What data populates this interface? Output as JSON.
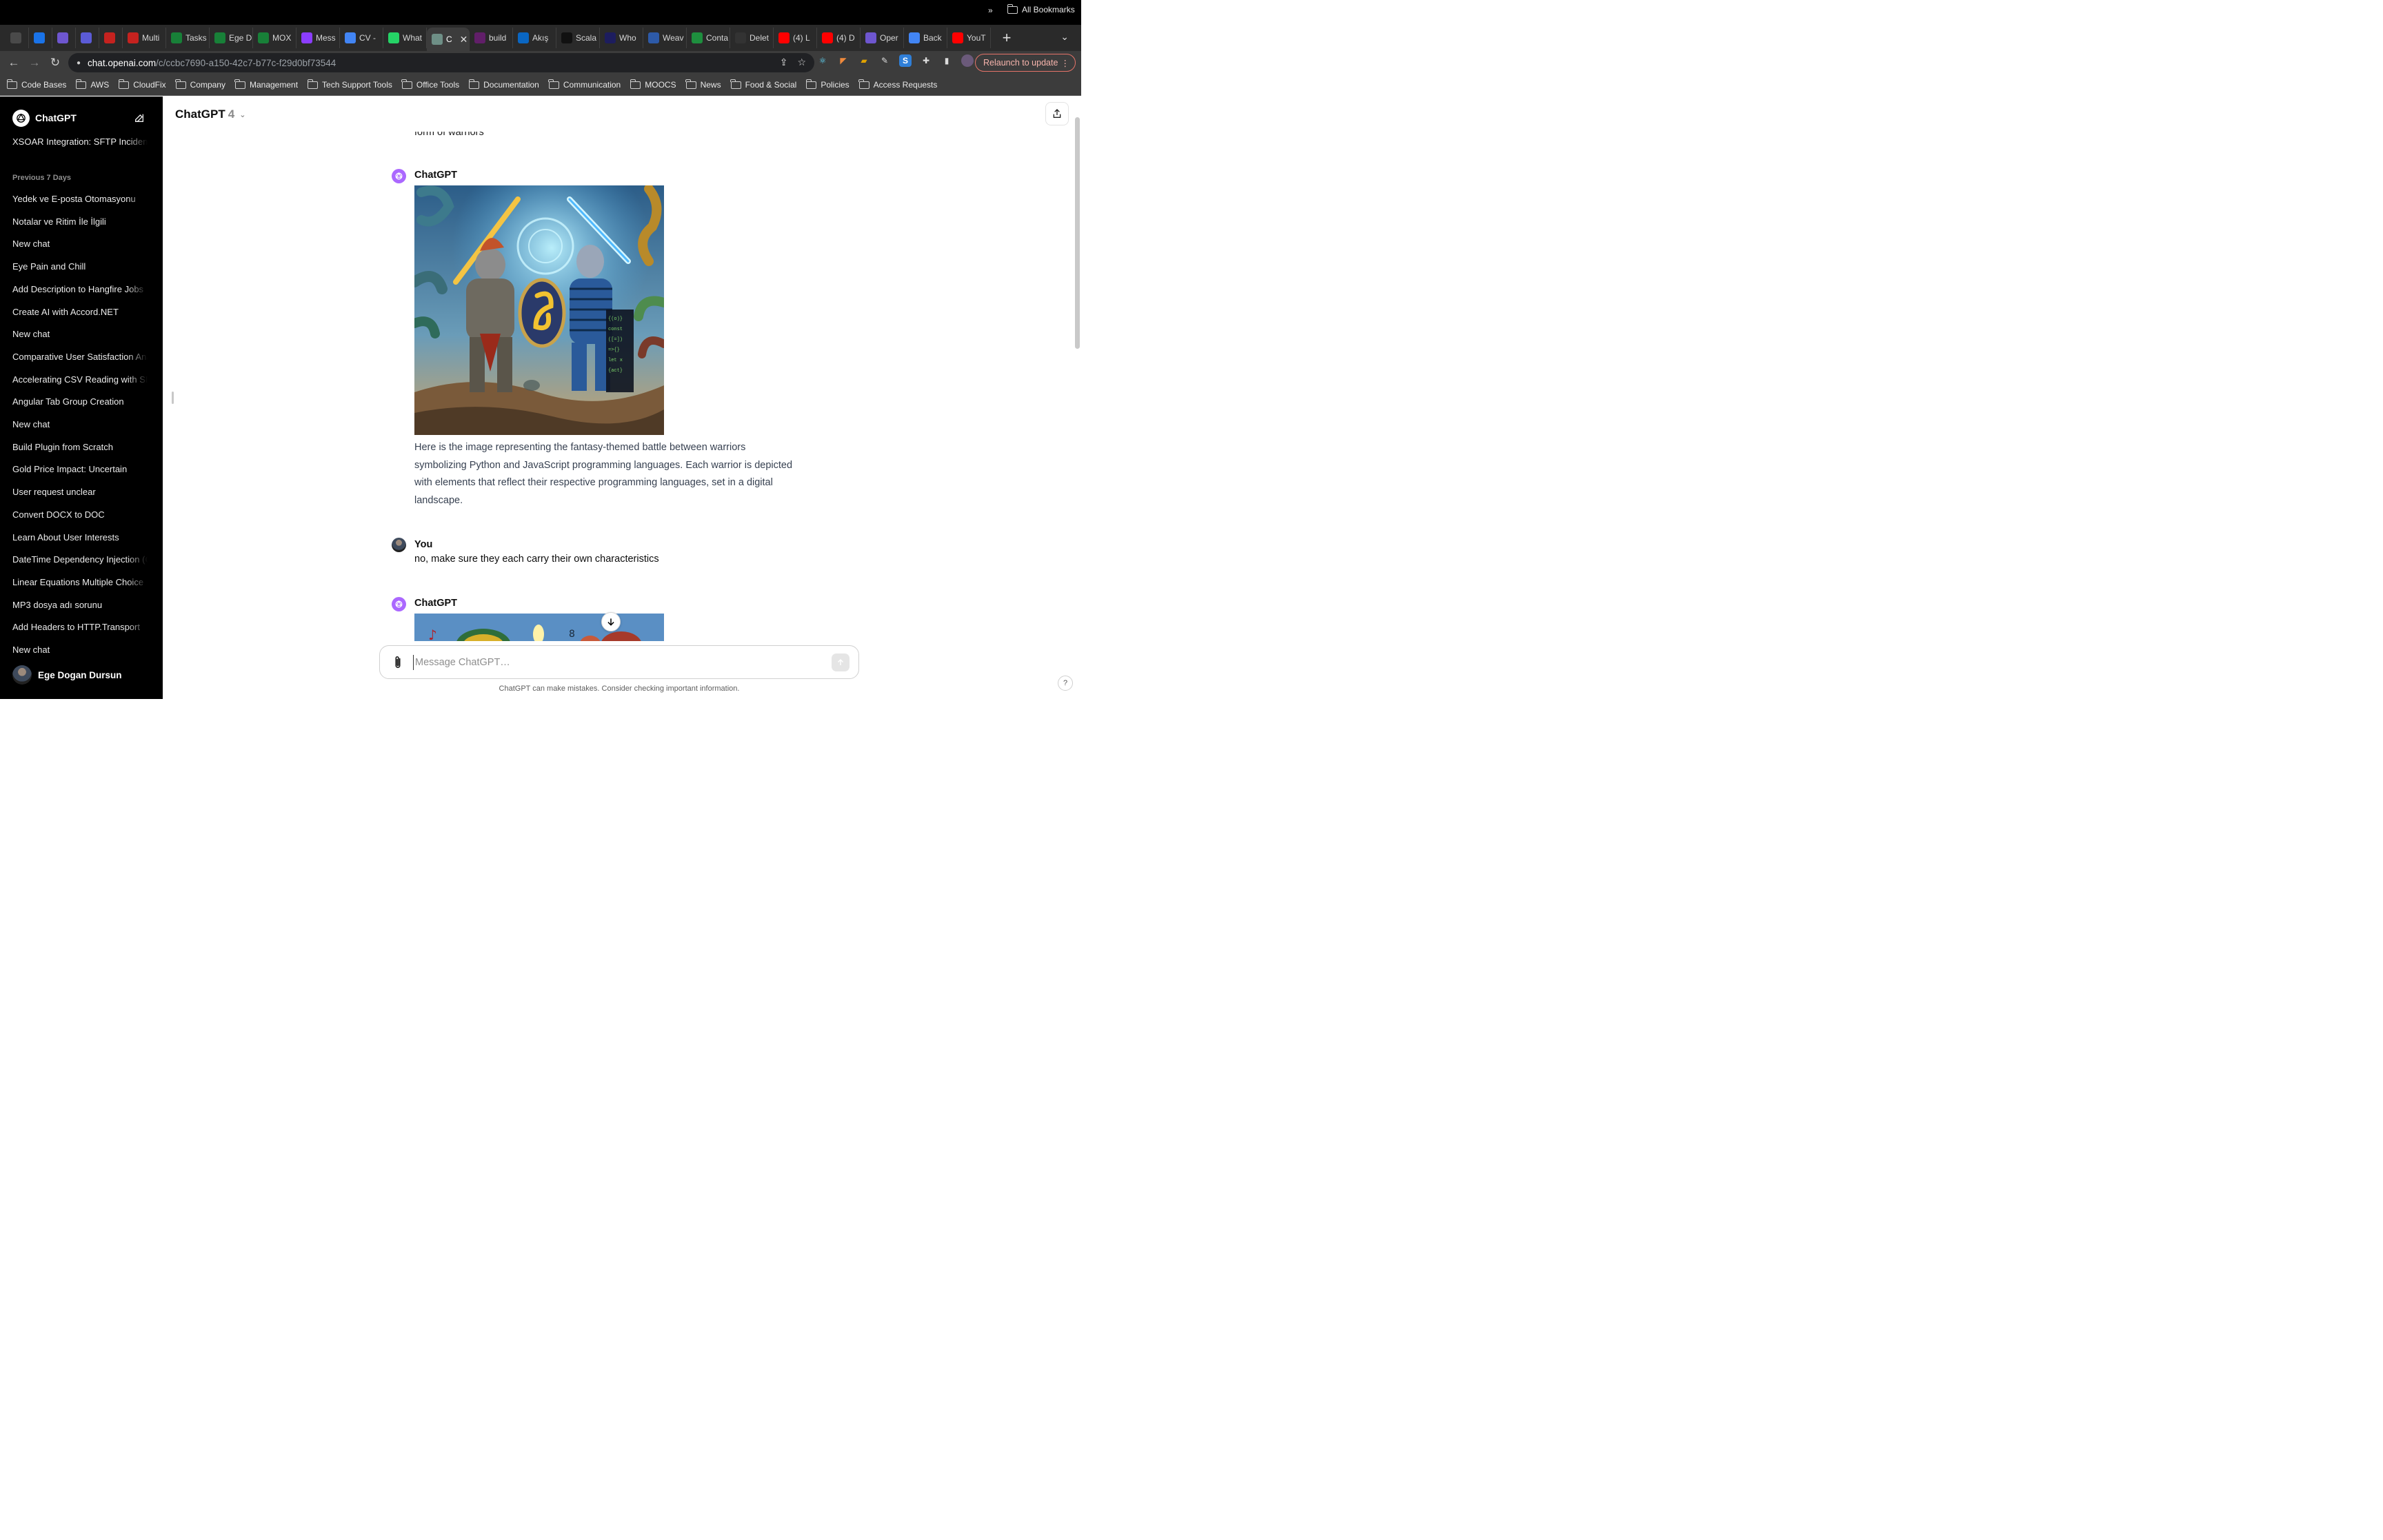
{
  "browser": {
    "tabs": [
      {
        "label": "",
        "icon": "apps-grid-icon",
        "color": "#4a4a4a"
      },
      {
        "label": "",
        "icon": "outlook-icon",
        "color": "#1a73e8"
      },
      {
        "label": "",
        "icon": "openai-icon",
        "color": "#6e56cf"
      },
      {
        "label": "",
        "icon": "clockwise-icon",
        "color": "#5b5bd6"
      },
      {
        "label": "",
        "icon": "gmail-icon",
        "color": "#c5221f"
      },
      {
        "label": "Multi",
        "icon": "gmail-icon",
        "color": "#c5221f"
      },
      {
        "label": "Tasks",
        "icon": "tasks-icon",
        "color": "#188038"
      },
      {
        "label": "Ege D",
        "icon": "sheets-icon",
        "color": "#188038"
      },
      {
        "label": "MOX",
        "icon": "sheets-icon",
        "color": "#188038"
      },
      {
        "label": "Mess",
        "icon": "messenger-icon",
        "color": "#8b3dff"
      },
      {
        "label": "CV -",
        "icon": "docs-icon",
        "color": "#4285f4"
      },
      {
        "label": "What",
        "icon": "whatsapp-icon",
        "color": "#25d366"
      },
      {
        "label": "C",
        "icon": "chatgpt-icon",
        "color": "#6e8f86",
        "active": true
      },
      {
        "label": "build",
        "icon": "slack-icon",
        "color": "#611f69"
      },
      {
        "label": "Akış",
        "icon": "linkedin-icon",
        "color": "#0a66c2"
      },
      {
        "label": "Scala",
        "icon": "medium-icon",
        "color": "#111111"
      },
      {
        "label": "Who",
        "icon": "vercel-icon",
        "color": "#1d1d5e"
      },
      {
        "label": "Weav",
        "icon": "weave-icon",
        "color": "#2d5aa8"
      },
      {
        "label": "Conta",
        "icon": "dot-icon",
        "color": "#1e8e3e"
      },
      {
        "label": "Delet",
        "icon": "github-icon",
        "color": "#333333"
      },
      {
        "label": "(4) L",
        "icon": "youtube-icon",
        "color": "#ff0000"
      },
      {
        "label": "(4) D",
        "icon": "youtube-icon",
        "color": "#ff0000"
      },
      {
        "label": "Oper",
        "icon": "openai-icon",
        "color": "#6e56cf"
      },
      {
        "label": "Back",
        "icon": "docs-icon",
        "color": "#4285f4"
      },
      {
        "label": "YouT",
        "icon": "youtube-icon",
        "color": "#ff0000"
      }
    ],
    "url_host": "chat.openai.com",
    "url_path": "/c/ccbc7690-a150-42c7-b77c-f29d0bf73544",
    "relaunch_label": "Relaunch to update",
    "bookmarks": [
      "Code Bases",
      "AWS",
      "CloudFix",
      "Company",
      "Management",
      "Tech Support Tools",
      "Office Tools",
      "Documentation",
      "Communication",
      "MOOCS",
      "News",
      "Food & Social",
      "Policies",
      "Access Requests"
    ],
    "bookmarks_more": "»",
    "all_bookmarks": "All Bookmarks"
  },
  "sidebar": {
    "title": "ChatGPT",
    "pinned_chat": "XSOAR Integration: SFTP Incident",
    "section_label": "Previous 7 Days",
    "chats": [
      "Yedek ve E-posta Otomasyonu",
      "Notalar ve Ritim İle İlgili",
      "New chat",
      "Eye Pain and Chill",
      "Add Description to Hangfire Jobs",
      "Create AI with Accord.NET",
      "New chat",
      "Comparative User Satisfaction Analysis",
      "Accelerating CSV Reading with SIMD",
      "Angular Tab Group Creation",
      "New chat",
      "Build Plugin from Scratch",
      "Gold Price Impact: Uncertain",
      "User request unclear",
      "Convert DOCX to DOC",
      "Learn About User Interests",
      "DateTime Dependency Injection (C#)",
      "Linear Equations Multiple Choice",
      "MP3 dosya adı sorunu",
      "Add Headers to HTTP.Transport",
      "New chat"
    ],
    "user_name": "Ege Dogan Dursun"
  },
  "main": {
    "model_name": "ChatGPT",
    "model_version": "4",
    "cut_off_text": "form of warriors",
    "assistant_name": "ChatGPT",
    "assistant_reply": "Here is the image representing the fantasy-themed battle between warriors symbolizing Python and JavaScript programming languages. Each warrior is depicted with elements that reflect their respective programming languages, set in a digital landscape.",
    "user_name": "You",
    "user_message": "no, make sure they each carry their own characteristics",
    "assistant_name_2": "ChatGPT",
    "composer_placeholder": "Message ChatGPT…",
    "disclaimer": "ChatGPT can make mistakes. Consider checking important information.",
    "help_label": "?"
  },
  "colors": {
    "sidebar_bg": "#000000",
    "assistant_avatar": "#ab68ff",
    "relaunch_border": "#e57368"
  }
}
